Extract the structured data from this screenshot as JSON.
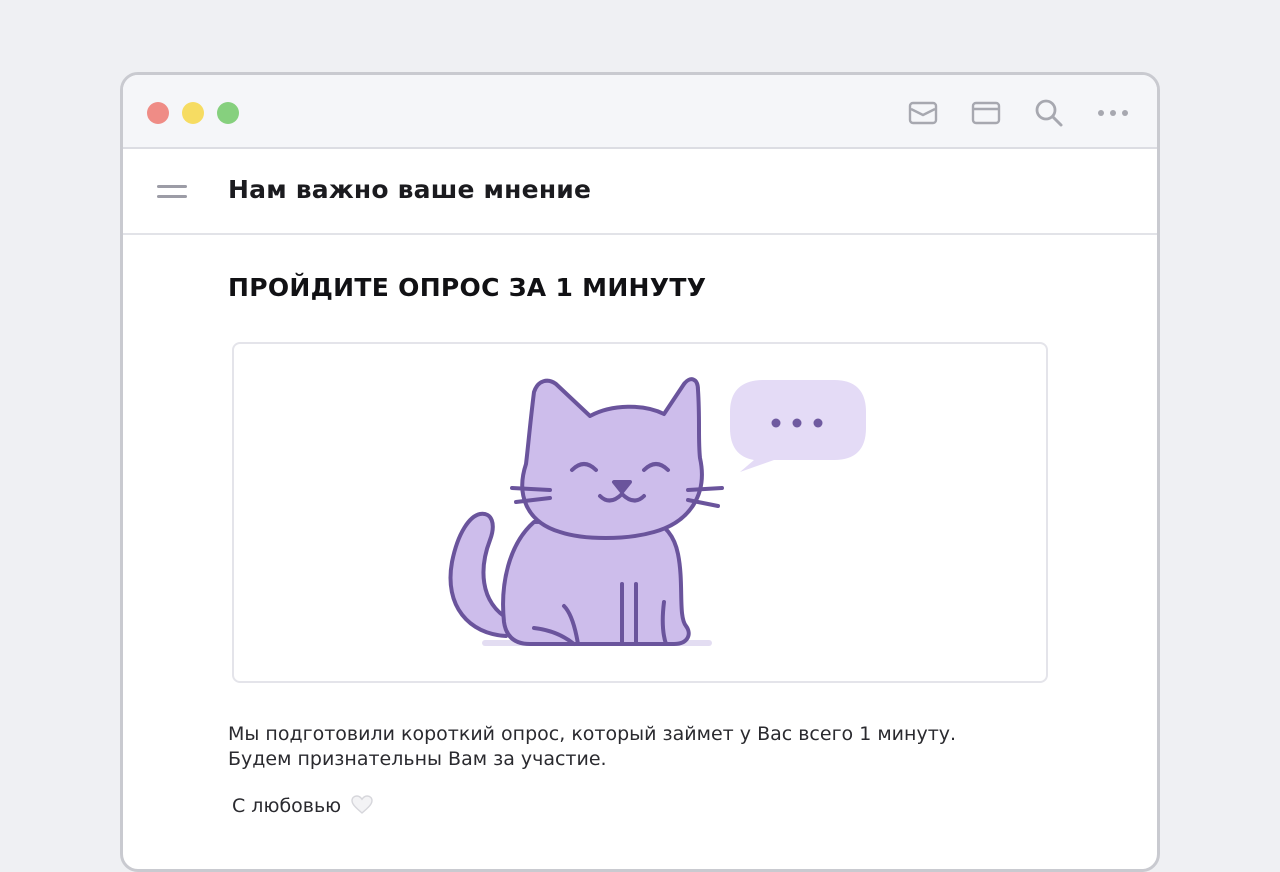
{
  "colors": {
    "accent": "#7b5fae",
    "illustration_fill": "#cdbdeb",
    "bubble_fill": "#e4dbf6"
  },
  "titlebar": {
    "traffic_lights": [
      "close",
      "minimize",
      "maximize"
    ],
    "icons": [
      "mail-icon",
      "window-icon",
      "search-icon",
      "more-icon"
    ]
  },
  "header": {
    "menu_icon": "hamburger-icon",
    "title": "Нам важно ваше мнение"
  },
  "content": {
    "heading": "ПРОЙДИТЕ ОПРОС ЗА 1 МИНУТУ",
    "illustration": {
      "subject": "cat-icon",
      "speech_bubble": "speech-bubble-icon"
    },
    "paragraph_line1": "Мы подготовили короткий опрос, который займет у Вас всего 1 минуту.",
    "paragraph_line2": "Будем признательны Вам за участие.",
    "signature": "С любовью",
    "signature_icon": "heart-icon"
  }
}
